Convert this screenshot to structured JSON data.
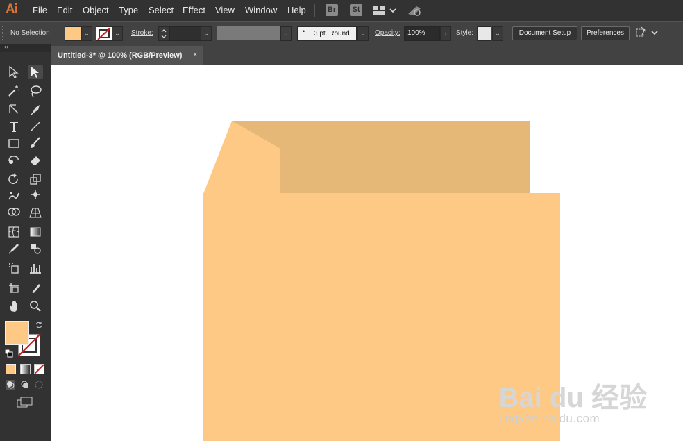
{
  "app": {
    "logo": "Ai"
  },
  "menu": {
    "items": [
      "File",
      "Edit",
      "Object",
      "Type",
      "Select",
      "Effect",
      "View",
      "Window",
      "Help"
    ]
  },
  "menubar_right": {
    "bridge": "Br",
    "stock": "St"
  },
  "control": {
    "selection_label": "No Selection",
    "stroke_label": "Stroke:",
    "stroke_weight": "",
    "brush_value": "3 pt. Round",
    "opacity_label": "Opacity:",
    "opacity_value": "100%",
    "style_label": "Style:",
    "document_setup": "Document Setup",
    "preferences": "Preferences"
  },
  "document": {
    "tab_title": "Untitled-3* @ 100% (RGB/Preview)",
    "close": "×"
  },
  "colors": {
    "fill": "#fec985",
    "shape_front": "#fec985",
    "shape_back": "#e6b877",
    "menubar_bg": "#323232",
    "panel_bg": "#424242",
    "workspace_bg": "#535353",
    "logo": "#d8763a"
  },
  "toolbar": {
    "collapse": "‹‹",
    "tools": [
      [
        "selection-tool",
        "direct-selection-tool"
      ],
      [
        "magic-wand-tool",
        "lasso-tool"
      ],
      [
        "pen-tool",
        "curvature-tool"
      ],
      [
        "type-tool",
        "line-segment-tool"
      ],
      [
        "rectangle-tool",
        "paintbrush-tool"
      ],
      [
        "shaper-tool",
        "eraser-tool"
      ],
      [
        "rotate-tool",
        "scale-tool"
      ],
      [
        "warp-tool",
        "puppet-warp-tool"
      ],
      [
        "shape-builder-tool",
        "perspective-grid-tool"
      ],
      [
        "mesh-tool",
        "gradient-tool"
      ],
      [
        "eyedropper-tool",
        "blend-tool"
      ],
      [
        "symbol-sprayer-tool",
        "column-graph-tool"
      ],
      [
        "artboard-tool",
        "slice-tool"
      ],
      [
        "hand-tool",
        "zoom-tool"
      ]
    ]
  },
  "watermark": {
    "top": "Bai du 经验",
    "bottom": "jingyan.baidu.com"
  }
}
